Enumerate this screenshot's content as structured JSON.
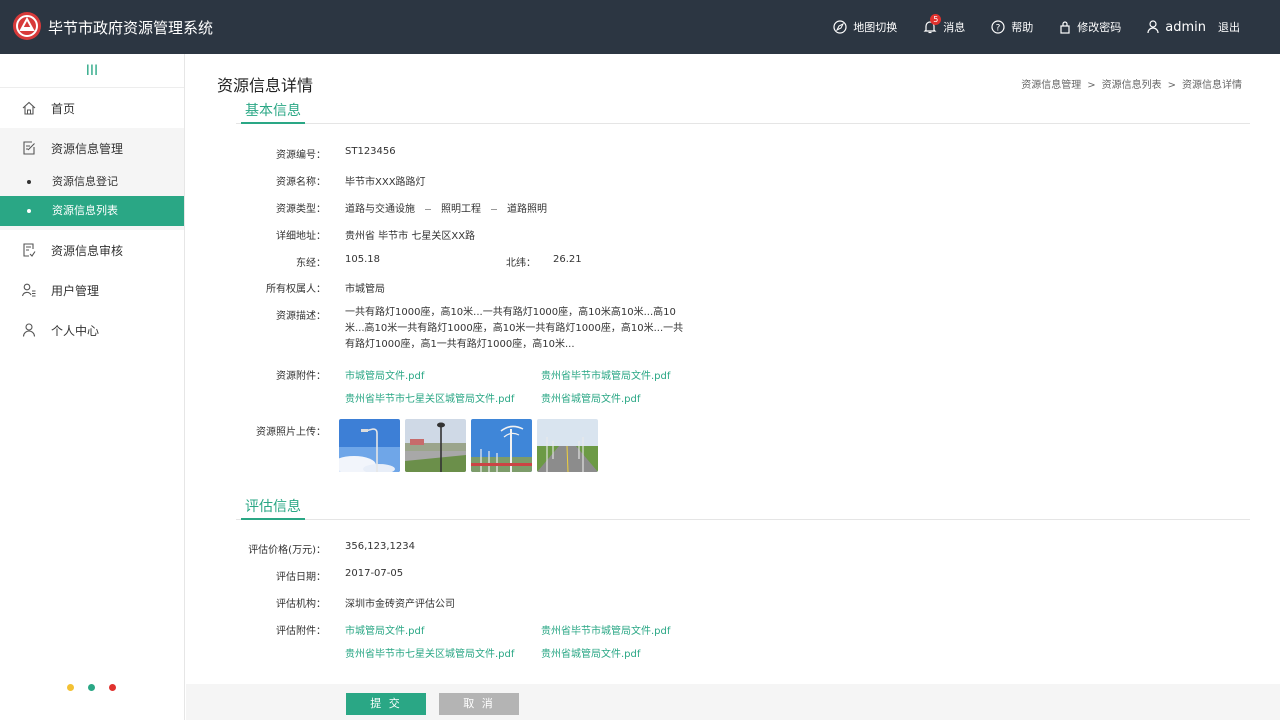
{
  "header": {
    "title": "毕节市政府资源管理系统",
    "map_switch": "地图切换",
    "messages": "消息",
    "message_count": "5",
    "help": "帮助",
    "change_password": "修改密码",
    "username": "admin",
    "logout": "退出"
  },
  "sidebar": {
    "toggle": "III",
    "items": [
      {
        "label": "首页",
        "icon": "home-icon"
      },
      {
        "label": "资源信息管理",
        "icon": "edit-doc-icon"
      },
      {
        "label": "资源信息审核",
        "icon": "check-doc-icon"
      },
      {
        "label": "用户管理",
        "icon": "user-list-icon"
      },
      {
        "label": "个人中心",
        "icon": "person-icon"
      }
    ],
    "sub_items": [
      "资源信息登记",
      "资源信息列表"
    ],
    "dots_colors": [
      "#f3c133",
      "#2aa785",
      "#e0312e"
    ]
  },
  "page": {
    "title": "资源信息详情",
    "breadcrumb": [
      "资源信息管理",
      "资源信息列表",
      "资源信息详情"
    ],
    "breadcrumb_sep": ">"
  },
  "basic": {
    "heading": "基本信息",
    "code_label": "资源编号：",
    "code": "ST123456",
    "name_label": "资源名称：",
    "name": "毕节市XXX路路灯",
    "type_label": "资源类型：",
    "type": [
      "道路与交通设施",
      "照明工程",
      "道路照明"
    ],
    "address_label": "详细地址：",
    "address": "贵州省 毕节市 七星关区XX路",
    "lng_label": "东经：",
    "lng": "105.18",
    "lat_label": "北纬：",
    "lat": "26.21",
    "owner_label": "所有权属人：",
    "owner": "市城管局",
    "desc_label": "资源描述：",
    "desc": "一共有路灯1000座，高10米...一共有路灯1000座，高10米高10米...高10米...高10米一共有路灯1000座，高10米一共有路灯1000座，高10米...一共有路灯1000座，高1一共有路灯1000座，高10米...",
    "attach_label": "资源附件：",
    "attachments": [
      "市城管局文件.pdf",
      "贵州省毕节市城管局文件.pdf",
      "贵州省毕节市七星关区城管局文件.pdf",
      "贵州省城管局文件.pdf"
    ],
    "photos_label": "资源照片上传："
  },
  "evaluation": {
    "heading": "评估信息",
    "price_label": "评估价格(万元)：",
    "price": "356,123,1234",
    "date_label": "评估日期：",
    "date": "2017-07-05",
    "org_label": "评估机构：",
    "org": "深圳市金砖资产评估公司",
    "attach_label": "评估附件：",
    "attachments": [
      "市城管局文件.pdf",
      "贵州省毕节市城管局文件.pdf",
      "贵州省毕节市七星关区城管局文件.pdf",
      "贵州省城管局文件.pdf"
    ]
  },
  "actions": {
    "submit": "提 交",
    "cancel": "取 消"
  },
  "colors": {
    "accent": "#2aa785",
    "header_bg": "#2c3642",
    "logo": "#d83a3a"
  }
}
